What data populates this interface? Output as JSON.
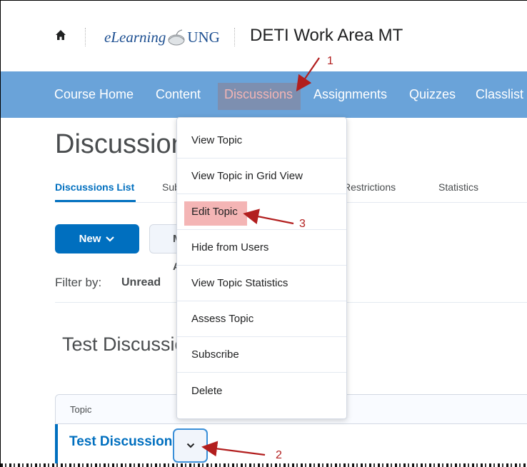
{
  "header": {
    "logo_prefix": "eLearning",
    "logo_suffix": "UNG",
    "course_title": "DETI Work Area MT"
  },
  "nav": {
    "items": [
      {
        "label": "Course Home"
      },
      {
        "label": "Content"
      },
      {
        "label": "Discussions",
        "active": true
      },
      {
        "label": "Assignments"
      },
      {
        "label": "Quizzes"
      },
      {
        "label": "Classlist"
      }
    ]
  },
  "page": {
    "title": "Discussions",
    "tabs": [
      {
        "label": "Discussions List",
        "active": true
      },
      {
        "label": "Subscriptions"
      },
      {
        "label": "Restrictions"
      },
      {
        "label": "Statistics"
      }
    ],
    "new_button": "New",
    "more_button": "More Actions",
    "filter_label": "Filter by:",
    "filter_value": "Unread",
    "section_title": "Test Discussions",
    "table_header": "Topic",
    "topic_name": "Test Discussion"
  },
  "menu": {
    "items": [
      {
        "label": "View Topic"
      },
      {
        "label": "View Topic in Grid View"
      },
      {
        "label": "Edit Topic",
        "highlighted": true
      },
      {
        "label": "Hide from Users"
      },
      {
        "label": "View Topic Statistics"
      },
      {
        "label": "Assess Topic"
      },
      {
        "label": "Subscribe"
      },
      {
        "label": "Delete"
      }
    ]
  },
  "annotations": {
    "step1": "1",
    "step2": "2",
    "step3": "3"
  },
  "colors": {
    "nav_bg": "#6aa3d9",
    "primary": "#006fbf",
    "annotation": "#b21e1e",
    "highlight": "#f4b5b5"
  }
}
